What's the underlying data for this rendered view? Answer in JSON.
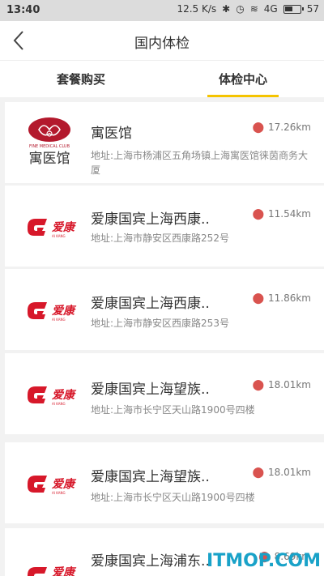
{
  "status_bar": {
    "time": "13:40",
    "speed": "12.5 K/s",
    "network": "4G",
    "battery": "57"
  },
  "header": {
    "title": "国内体检"
  },
  "tabs": [
    {
      "label": "套餐购买",
      "active": false
    },
    {
      "label": "体检中心",
      "active": true
    }
  ],
  "accent_color": "#f5c400",
  "items": [
    {
      "name": "寓医馆",
      "distance": "17.26km",
      "address": "地址:上海市杨浦区五角场镇上海寓医馆徕茵商务大厦",
      "logo": "fine-medical-club-logo",
      "logo_text": "FINE MEDICAL CLUB",
      "logo_cn": "寓医馆"
    },
    {
      "name": "爱康国宾上海西康..",
      "distance": "11.54km",
      "address": "地址:上海市静安区西康路252号",
      "logo": "aikang-logo",
      "logo_cn": "爱康"
    },
    {
      "name": "爱康国宾上海西康..",
      "distance": "11.86km",
      "address": "地址:上海市静安区西康路253号",
      "logo": "aikang-logo",
      "logo_cn": "爱康"
    },
    {
      "name": "爱康国宾上海望族..",
      "distance": "18.01km",
      "address": "地址:上海市长宁区天山路1900号四楼",
      "logo": "aikang-logo",
      "logo_cn": "爱康"
    },
    {
      "name": "爱康国宾上海望族..",
      "distance": "18.01km",
      "address": "地址:上海市长宁区天山路1900号四楼",
      "logo": "aikang-logo",
      "logo_cn": "爱康"
    },
    {
      "name": "爱康国宾上海浦东..",
      "distance": "8.69km",
      "address": "",
      "logo": "aikang-logo",
      "logo_cn": "爱康"
    }
  ],
  "watermark": {
    "text": "ITMOP.COM"
  }
}
